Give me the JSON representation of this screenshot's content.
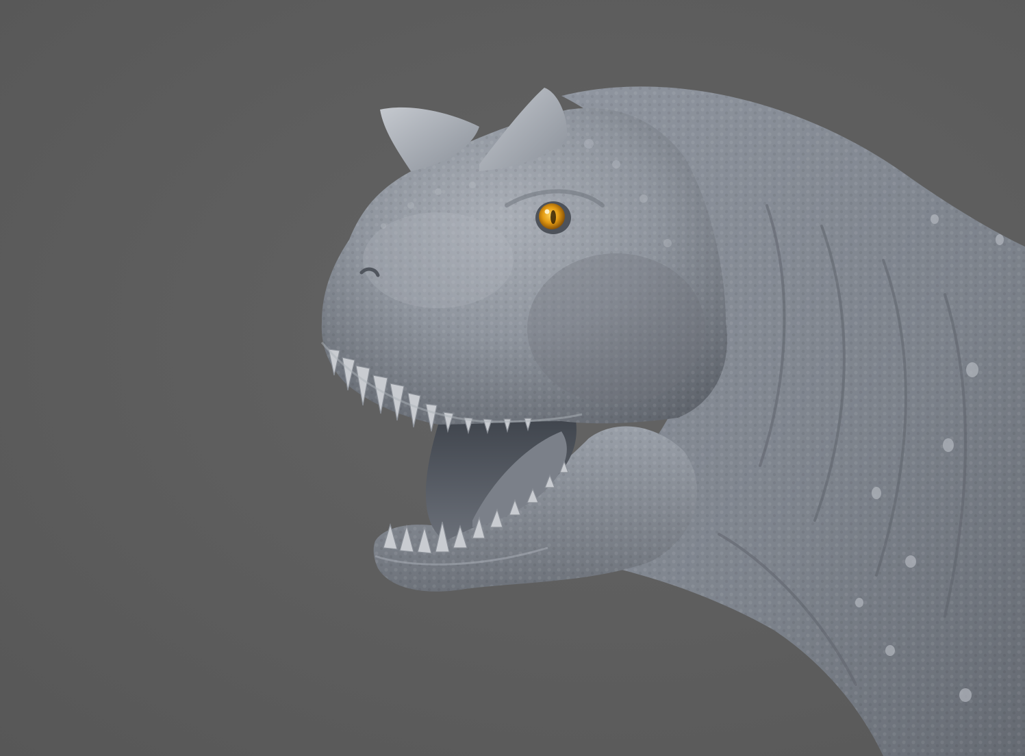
{
  "scene": {
    "subject": "carnotaurus-head-sculpt",
    "background_color": "#5d5d5d",
    "skin_color": "#8e949d",
    "skin_highlight_color": "#b8bcc3",
    "skin_shadow_color": "#5b6068",
    "eye_color": "#e39a12",
    "mouth_color": "#4a4f57",
    "teeth_color": "#c9ccd1"
  }
}
